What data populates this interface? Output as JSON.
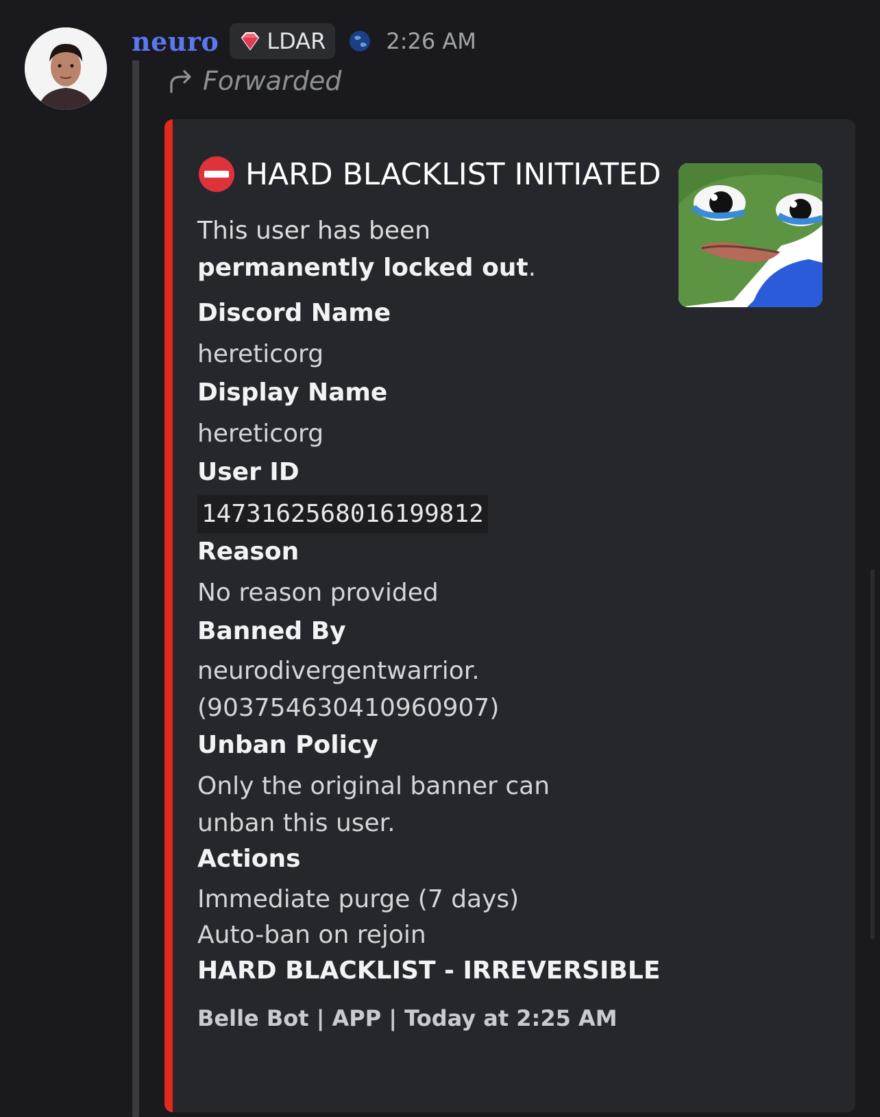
{
  "message": {
    "username": "neuro",
    "tag": "LDAR",
    "timestamp": "2:26 AM",
    "forwarded_label": "Forwarded"
  },
  "embed": {
    "accent_color": "#e1291c",
    "title": "HARD BLACKLIST INITIATED",
    "desc_prefix": "This user has been ",
    "desc_bold": "permanently locked out",
    "desc_suffix": ".",
    "fields": {
      "discord_name_label": "Discord Name",
      "discord_name_value": "hereticorg",
      "display_name_label": "Display Name",
      "display_name_value": "hereticorg",
      "user_id_label": "User ID",
      "user_id_value": "1473162568016199812",
      "reason_label": "Reason",
      "reason_value": "No reason provided",
      "banned_by_label": "Banned By",
      "banned_by_line1": "neurodivergentwarrior.",
      "banned_by_line2": "(903754630410960907)",
      "unban_policy_label": "Unban Policy",
      "unban_policy_value": "Only the original banner can unban this user.",
      "actions_label": "Actions",
      "actions_line1": "Immediate purge (7 days)",
      "actions_line2": "Auto-ban on rejoin",
      "actions_line3": "HARD BLACKLIST - IRREVERSIBLE"
    },
    "footer": "Belle Bot | APP | Today at 2:25 AM"
  }
}
